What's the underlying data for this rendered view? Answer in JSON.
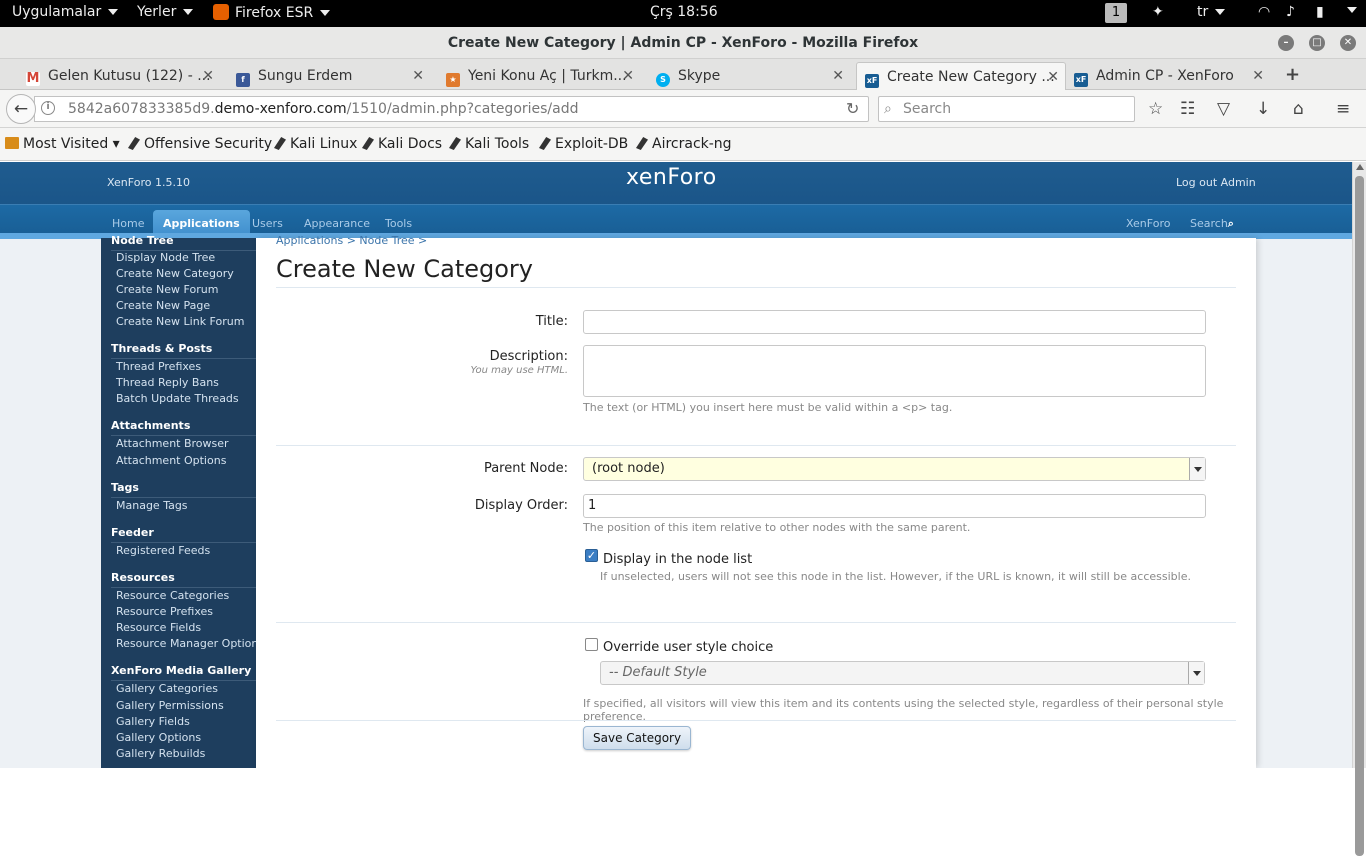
{
  "desktop": {
    "apps_menu": "Uygulamalar",
    "places_menu": "Yerler",
    "app_name": "Firefox ESR",
    "clock": "Çrş 18:56",
    "workspace": "1",
    "lang": "tr"
  },
  "window": {
    "title": "Create New Category | Admin CP - XenForo - Mozilla Firefox"
  },
  "tabs": [
    {
      "label": "Gelen Kutusu (122) - ..."
    },
    {
      "label": "Sungu Erdem"
    },
    {
      "label": "Yeni Konu Aç | Turkm..."
    },
    {
      "label": "Skype"
    },
    {
      "label": "Create New Category ..."
    },
    {
      "label": "Admin CP - XenForo"
    }
  ],
  "nav": {
    "url_pre": "5842a607833385d9.",
    "url_domain": "demo-xenforo.com",
    "url_path": "/1510/admin.php?categories/add",
    "search_placeholder": "Search"
  },
  "bookmarks": [
    {
      "label": "Most Visited ▾"
    },
    {
      "label": "Offensive Security"
    },
    {
      "label": "Kali Linux"
    },
    {
      "label": "Kali Docs"
    },
    {
      "label": "Kali Tools"
    },
    {
      "label": "Exploit-DB"
    },
    {
      "label": "Aircrack-ng"
    }
  ],
  "xf": {
    "version": "XenForo 1.5.10",
    "logo": "xenForo",
    "logout": "Log out Admin",
    "nav": {
      "home": "Home",
      "applications": "Applications",
      "users": "Users",
      "appearance": "Appearance",
      "tools": "Tools",
      "xenforo": "XenForo",
      "search": "Search"
    }
  },
  "sidebar": {
    "node_tree": "Node Tree",
    "node_items": [
      "Display Node Tree",
      "Create New Category",
      "Create New Forum",
      "Create New Page",
      "Create New Link Forum"
    ],
    "threads": "Threads & Posts",
    "thread_items": [
      "Thread Prefixes",
      "Thread Reply Bans",
      "Batch Update Threads"
    ],
    "attachments": "Attachments",
    "attach_items": [
      "Attachment Browser",
      "Attachment Options"
    ],
    "tags": "Tags",
    "tag_items": [
      "Manage Tags"
    ],
    "feeder": "Feeder",
    "feeder_items": [
      "Registered Feeds"
    ],
    "resources": "Resources",
    "resource_items": [
      "Resource Categories",
      "Resource Prefixes",
      "Resource Fields",
      "Resource Manager Options"
    ],
    "gallery": "XenForo Media Gallery",
    "gallery_items": [
      "Gallery Categories",
      "Gallery Permissions",
      "Gallery Fields",
      "Gallery Options",
      "Gallery Rebuilds"
    ]
  },
  "form": {
    "breadcrumb": "Applications >   Node Tree >",
    "page_title": "Create New Category",
    "title_label": "Title:",
    "title_value": "",
    "description_label": "Description:",
    "description_hint": "You may use HTML.",
    "description_help": "The text (or HTML) you insert here must be valid within a <p> tag.",
    "parent_label": "Parent Node:",
    "parent_value": "(root node)",
    "order_label": "Display Order:",
    "order_value": "1",
    "order_help": "The position of this item relative to other nodes with the same parent.",
    "display_label": "Display in the node list",
    "display_help": "If unselected, users will not see this node in the list. However, if the URL is known, it will still be accessible.",
    "override_label": "Override user style choice",
    "style_value": "-- Default Style",
    "style_help": "If specified, all visitors will view this item and its contents using the selected style, regardless of their personal style preference.",
    "save_label": "Save Category"
  }
}
